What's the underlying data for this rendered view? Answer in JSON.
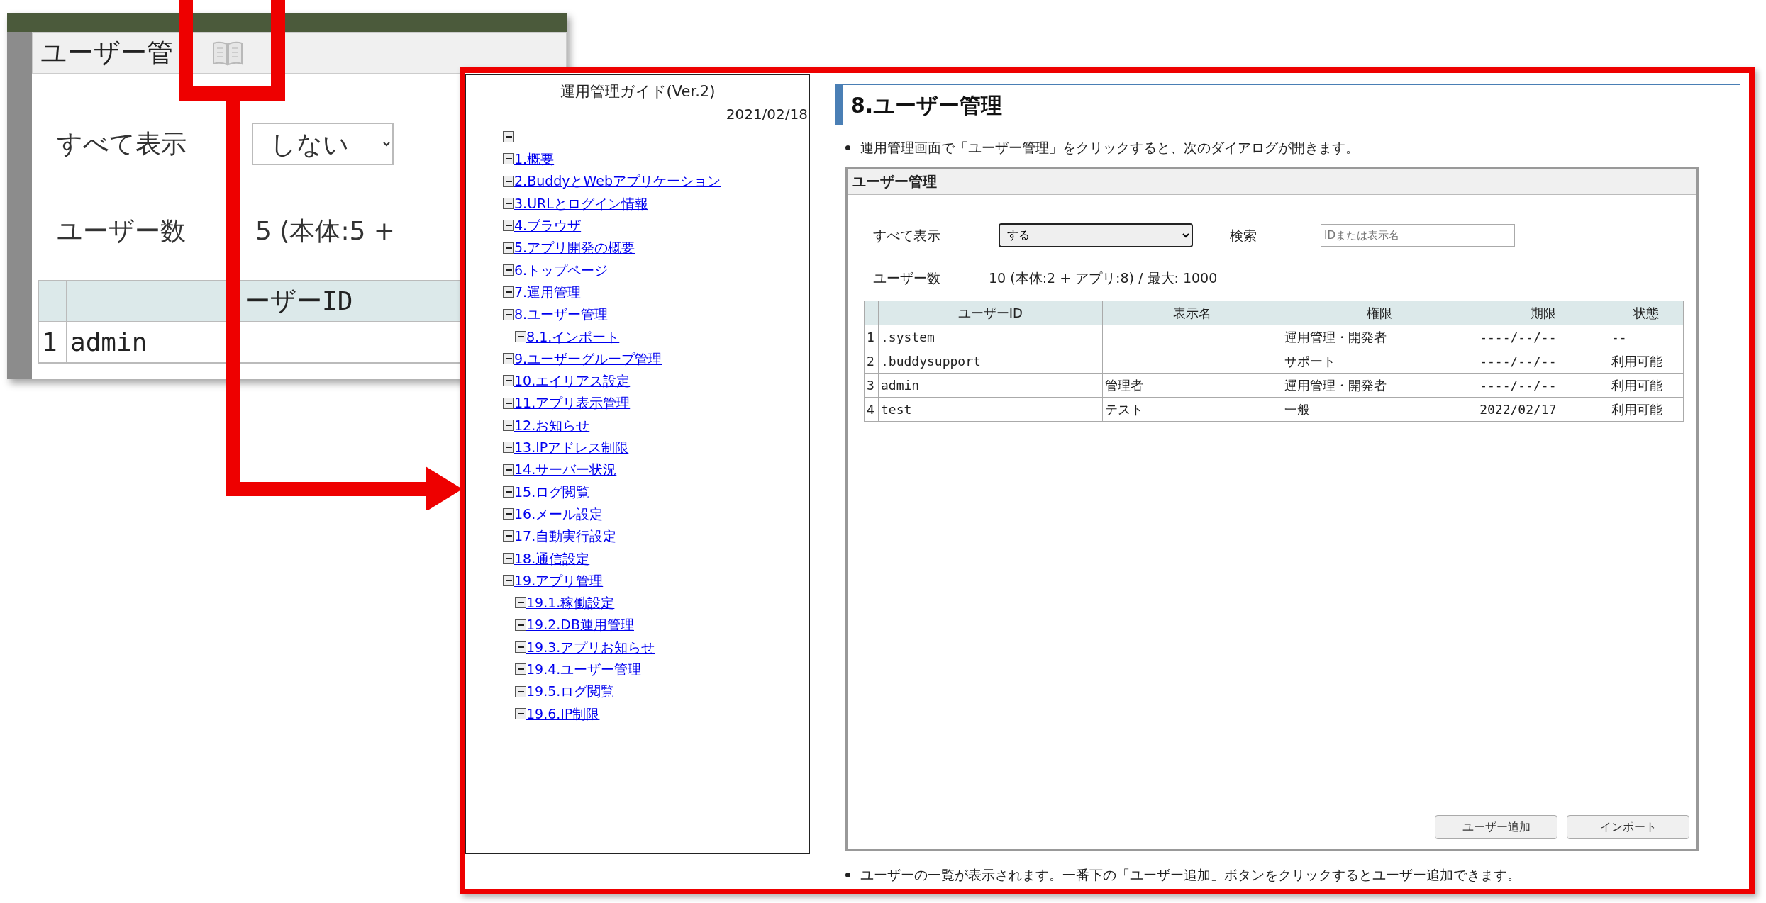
{
  "inset": {
    "title": "ユーザー管",
    "show_all_label": "すべて表示",
    "show_all_value": "しない",
    "user_count_label": "ユーザー数",
    "user_count_value": "5 (本体:5 +",
    "table": {
      "columns": [
        "ーザーID"
      ],
      "rows": [
        {
          "index": "1",
          "user_id": "admin"
        }
      ]
    }
  },
  "guide": {
    "title": "運用管理ガイド(Ver.2)",
    "date": "2021/02/18",
    "toc": {
      "expanded": true,
      "children": [
        {
          "label": "1.概要",
          "expanded": true
        },
        {
          "label": "2.BuddyとWebアプリケーション",
          "expanded": true
        },
        {
          "label": "3.URLとログイン情報",
          "expanded": true
        },
        {
          "label": "4.ブラウザ",
          "expanded": true
        },
        {
          "label": "5.アプリ開発の概要",
          "expanded": true
        },
        {
          "label": "6.トップページ",
          "expanded": true
        },
        {
          "label": "7.運用管理",
          "expanded": true
        },
        {
          "label": "8.ユーザー管理",
          "expanded": true,
          "children": [
            {
              "label": "8.1.インポート",
              "expanded": true
            }
          ]
        },
        {
          "label": "9.ユーザーグループ管理",
          "expanded": true
        },
        {
          "label": "10.エイリアス設定",
          "expanded": true
        },
        {
          "label": "11.アプリ表示管理",
          "expanded": true
        },
        {
          "label": "12.お知らせ",
          "expanded": true
        },
        {
          "label": "13.IPアドレス制限",
          "expanded": true
        },
        {
          "label": "14.サーバー状況",
          "expanded": true
        },
        {
          "label": "15.ログ閲覧",
          "expanded": true
        },
        {
          "label": "16.メール設定",
          "expanded": true
        },
        {
          "label": "17.自動実行設定",
          "expanded": true
        },
        {
          "label": "18.通信設定",
          "expanded": true
        },
        {
          "label": "19.アプリ管理",
          "expanded": true,
          "children": [
            {
              "label": "19.1.稼働設定",
              "expanded": true
            },
            {
              "label": "19.2.DB運用管理",
              "expanded": true
            },
            {
              "label": "19.3.アプリお知らせ",
              "expanded": true
            },
            {
              "label": "19.4.ユーザー管理",
              "expanded": true
            },
            {
              "label": "19.5.ログ閲覧",
              "expanded": true
            },
            {
              "label": "19.6.IP制限",
              "expanded": true
            }
          ]
        }
      ]
    }
  },
  "page": {
    "heading": "8.ユーザー管理",
    "intro": "運用管理画面で「ユーザー管理」をクリックすると、次のダイアログが開きます。",
    "dialog": {
      "title": "ユーザー管理",
      "show_all_label": "すべて表示",
      "show_all_value": "する",
      "search_label": "検索",
      "search_placeholder": "IDまたは表示名",
      "user_count_label": "ユーザー数",
      "user_count_value": "10 (本体:2 + アプリ:8) / 最大: 1000",
      "table": {
        "columns": [
          "ユーザーID",
          "表示名",
          "権限",
          "期限",
          "状態"
        ],
        "rows": [
          {
            "index": "1",
            "user_id": ".system",
            "role": "運用管理・開発者",
            "expiry": "----/--/--",
            "status": "--"
          },
          {
            "index": "2",
            "user_id": ".buddysupport",
            "role": "サポート",
            "expiry": "----/--/--",
            "status": "利用可能"
          },
          {
            "index": "3",
            "user_id": "admin",
            "display_name": "管理者",
            "role": "運用管理・開発者",
            "expiry": "----/--/--",
            "status": "利用可能"
          },
          {
            "index": "4",
            "user_id": "test",
            "display_name": "テスト",
            "role": "一般",
            "expiry": "2022/02/17",
            "status": "利用可能"
          }
        ]
      },
      "buttons": [
        "ユーザー追加",
        "インポート"
      ]
    },
    "note": "ユーザーの一覧が表示されます。一番下の「ユーザー追加」ボタンをクリックするとユーザー追加できます。"
  }
}
